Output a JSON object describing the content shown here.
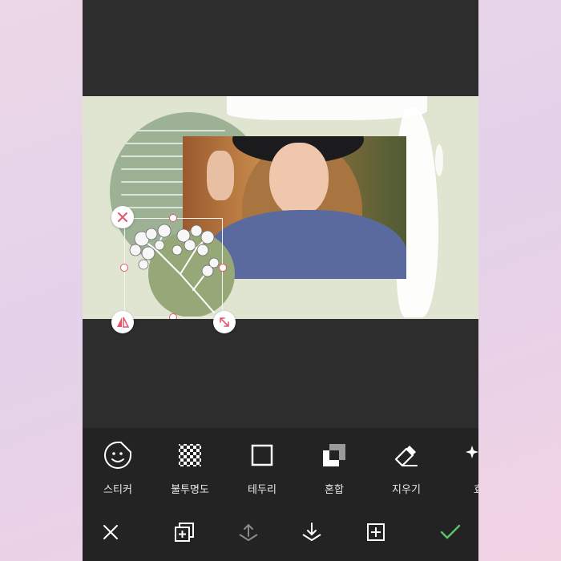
{
  "tools": [
    {
      "label": "스티커",
      "icon": "sticker-icon"
    },
    {
      "label": "불투명도",
      "icon": "opacity-icon"
    },
    {
      "label": "테두리",
      "icon": "border-icon"
    },
    {
      "label": "혼합",
      "icon": "blend-icon"
    },
    {
      "label": "지우기",
      "icon": "eraser-icon"
    },
    {
      "label": "효",
      "icon": "effects-icon"
    }
  ],
  "actions": [
    "close-icon",
    "duplicate-icon",
    "bring-up-icon",
    "send-down-icon",
    "add-icon",
    "check-icon"
  ],
  "colors": {
    "background": "#2d2d2d",
    "toolbar": "#232323",
    "canvas": "#e0e5d1",
    "sage": "#9db295",
    "handle_red": "#e4566a",
    "check_green": "#5cc36b"
  }
}
